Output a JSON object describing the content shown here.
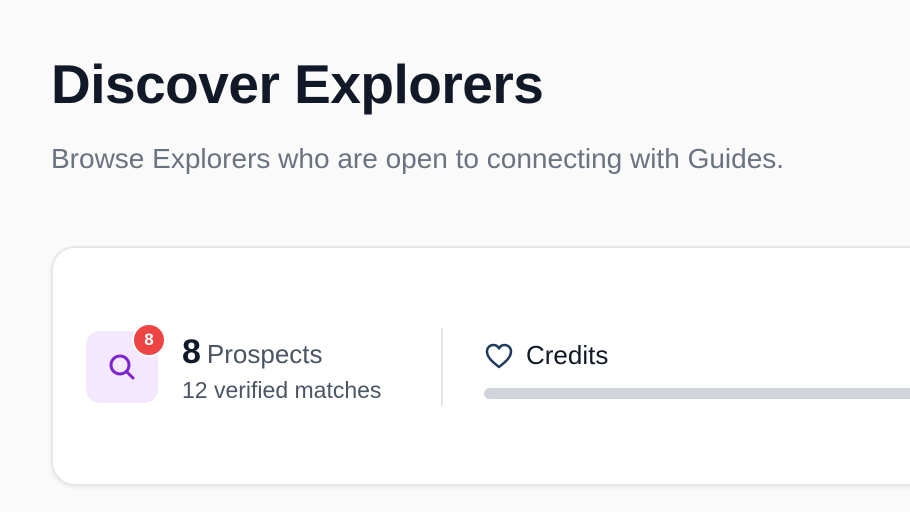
{
  "header": {
    "title": "Discover Explorers",
    "subtitle": "Browse Explorers who are open to connecting with Guides."
  },
  "stats_card": {
    "prospects": {
      "icon": "search-icon",
      "badge_count": "8",
      "count": "8",
      "label": "Prospects",
      "sublabel": "12 verified matches"
    },
    "credits": {
      "icon": "heart-icon",
      "label": "Credits"
    }
  },
  "colors": {
    "accent_purple": "#7e22ce",
    "badge_red": "#ef4444",
    "icon_tile_bg": "#f3e8ff",
    "heading": "#111827",
    "muted_text": "#6b7280",
    "progress_track": "#d1d5db"
  }
}
